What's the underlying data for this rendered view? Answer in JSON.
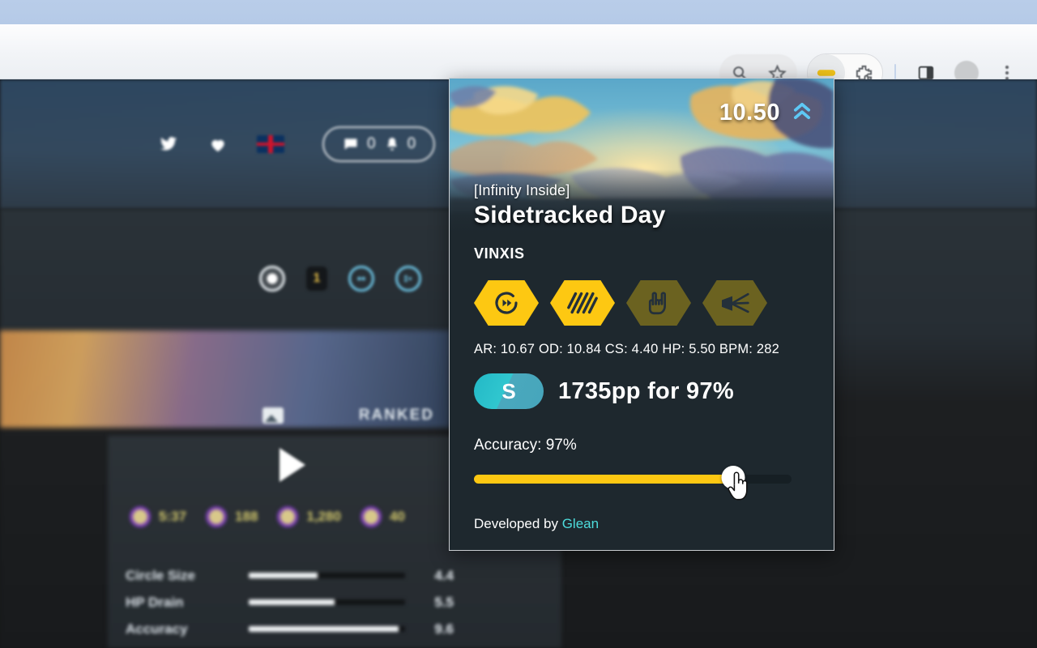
{
  "browser": {
    "toolbar_icons": [
      {
        "name": "search-icon",
        "glyph": "search"
      },
      {
        "name": "bookmark-star-icon",
        "glyph": "star"
      },
      {
        "name": "extension-active-icon",
        "glyph": "ext"
      },
      {
        "name": "extensions-puzzle-icon",
        "glyph": "puzzle"
      },
      {
        "name": "side-panel-icon",
        "glyph": "panel"
      },
      {
        "name": "profile-avatar",
        "glyph": "avatar"
      },
      {
        "name": "chrome-menu-icon",
        "glyph": "dots"
      }
    ]
  },
  "page": {
    "hero": {
      "twitter_label": "twitter",
      "heart_label": "supporter",
      "flag_label": "GB",
      "chat_count": "0",
      "notification_count": "0"
    },
    "mode_badge": "1",
    "status_badge": "RANKED",
    "stats": [
      {
        "label": "length",
        "value": "5:37"
      },
      {
        "label": "bpm",
        "value": "188"
      },
      {
        "label": "circles",
        "value": "1,280"
      },
      {
        "label": "sliders",
        "value": "40"
      }
    ],
    "attributes": [
      {
        "name": "Circle Size",
        "value": "4.4",
        "pct": 44
      },
      {
        "name": "HP Drain",
        "value": "5.5",
        "pct": 55
      },
      {
        "name": "Accuracy",
        "value": "9.6",
        "pct": 96
      }
    ]
  },
  "popup": {
    "star_rating": "10.50",
    "star_rating_icon": "double-chevron-up-icon",
    "version": "[Infinity Inside]",
    "title": "Sidetracked Day",
    "artist": "VINXIS",
    "mods": [
      {
        "name": "doubletime",
        "label": "DT",
        "enabled": true,
        "icon": "doubletime-icon"
      },
      {
        "name": "hidden",
        "label": "HD",
        "enabled": true,
        "icon": "hidden-icon"
      },
      {
        "name": "hardrock",
        "label": "HR",
        "enabled": false,
        "icon": "hardrock-icon"
      },
      {
        "name": "flashlight",
        "label": "FL",
        "enabled": false,
        "icon": "flashlight-icon"
      }
    ],
    "difficulty_line": "AR: 10.67 OD: 10.84 CS: 4.40 HP: 5.50 BPM: 282",
    "difficulty_values": {
      "AR": "10.67",
      "OD": "10.84",
      "CS": "4.40",
      "HP": "5.50",
      "BPM": "282"
    },
    "rank_letter": "S",
    "pp_text": "1735pp for 97%",
    "pp_value": "1735",
    "accuracy_label": "Accuracy: 97%",
    "accuracy_percent": 97,
    "slider_fill_pct": 82,
    "footer_prefix": "Developed by ",
    "footer_author": "Glean"
  },
  "colors": {
    "accent_yellow": "#fdc812",
    "accent_cyan": "#4ddcdc",
    "panel_dark": "#1e282e",
    "mod_dim": "#6b6220",
    "chevron_blue": "#5ec8f5"
  }
}
